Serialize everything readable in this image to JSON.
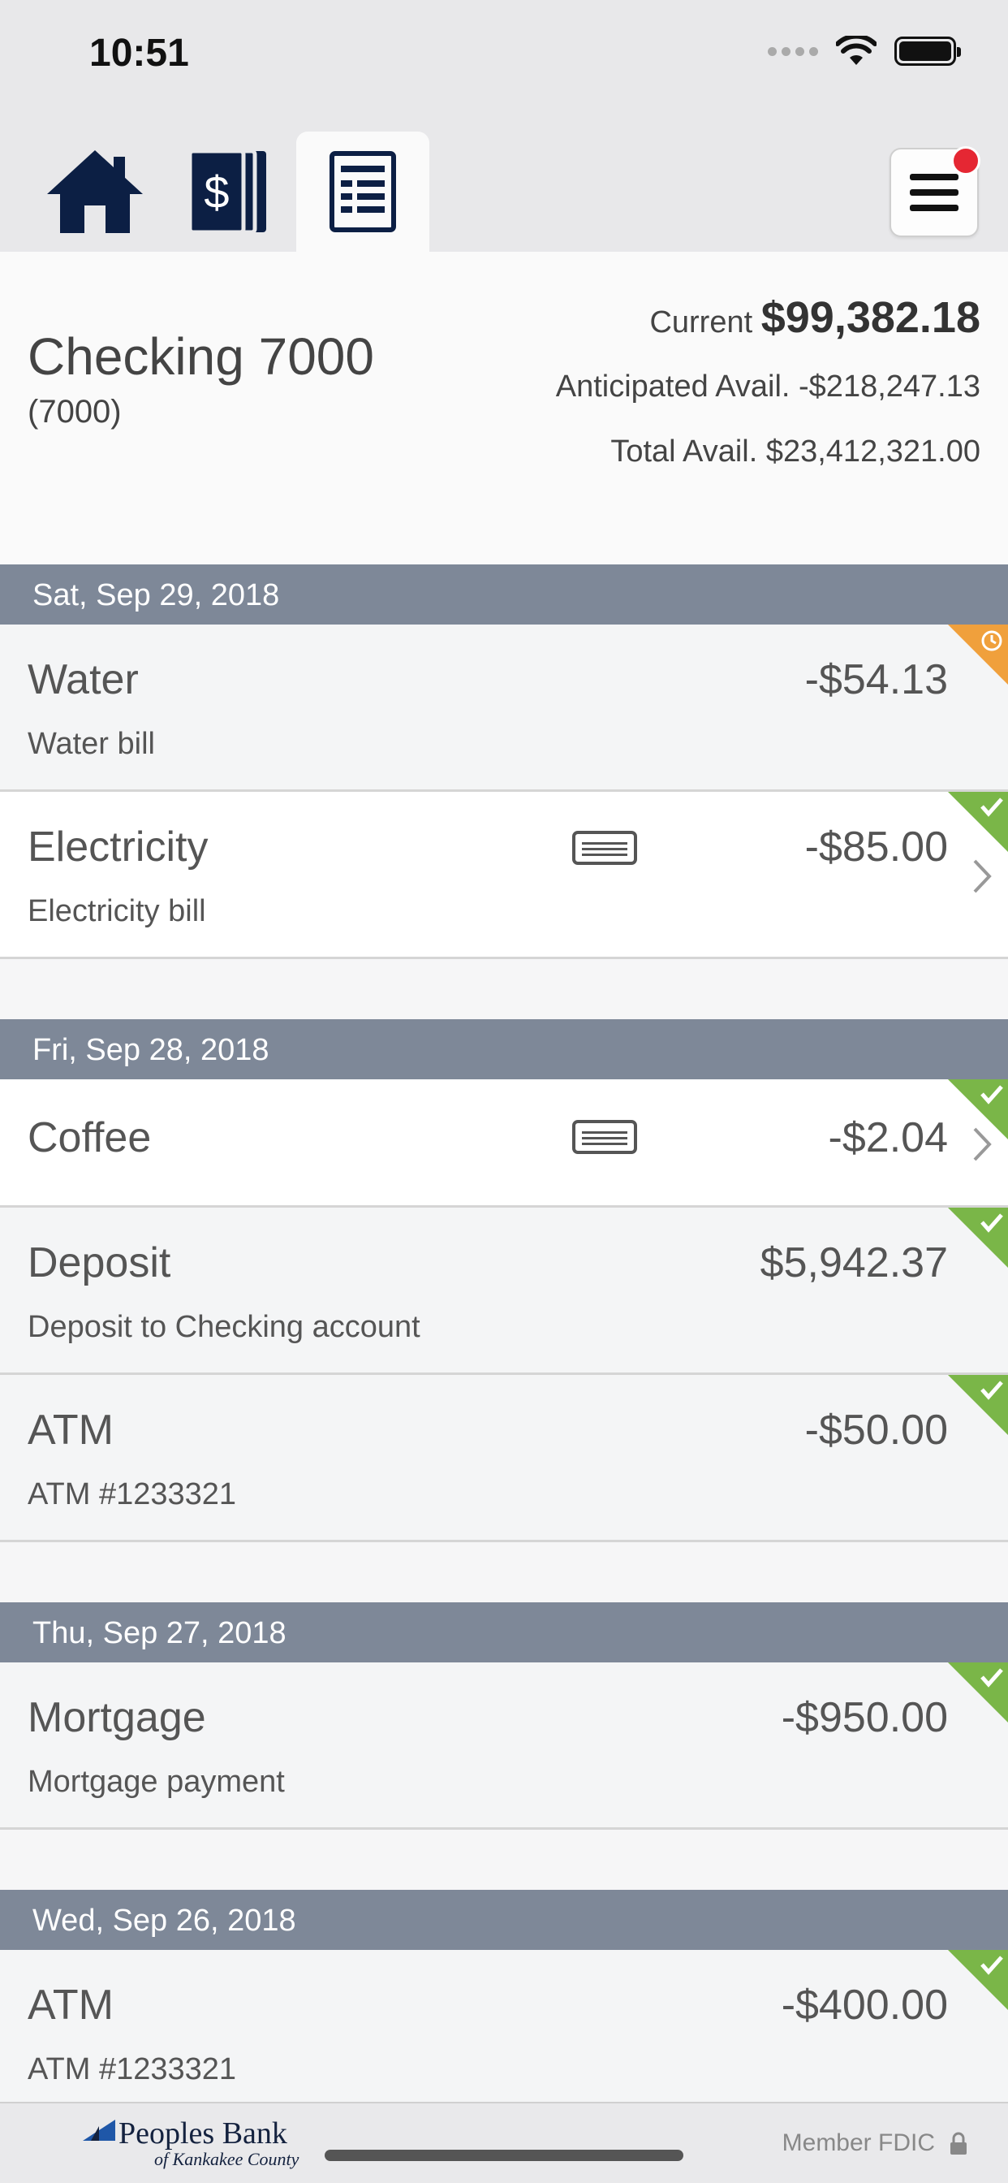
{
  "status_bar": {
    "time": "10:51"
  },
  "toolbar": {
    "tabs": [
      {
        "icon": "home-icon",
        "active": false
      },
      {
        "icon": "accounts-icon",
        "active": false
      },
      {
        "icon": "register-icon",
        "active": true
      }
    ],
    "menu_icon": "hamburger-menu-icon",
    "notification_badge_color": "#e52733"
  },
  "account": {
    "name": "Checking 7000",
    "number": "(7000)",
    "current_label": "Current",
    "current_value": "$99,382.18",
    "anticipated_label": "Anticipated Avail.",
    "anticipated_value": "-$218,247.13",
    "total_label": "Total Avail.",
    "total_value": "$23,412,321.00"
  },
  "groups": [
    {
      "date": "Sat, Sep 29, 2018",
      "transactions": [
        {
          "name": "Water",
          "memo": "Water bill",
          "amount": "-$54.13",
          "status": "pending",
          "has_card": false,
          "has_detail": false
        },
        {
          "name": "Electricity",
          "memo": "Electricity bill",
          "amount": "-$85.00",
          "status": "cleared",
          "has_card": true,
          "has_detail": true
        }
      ]
    },
    {
      "date": "Fri, Sep 28, 2018",
      "transactions": [
        {
          "name": "Coffee",
          "memo": "",
          "amount": "-$2.04",
          "status": "cleared",
          "has_card": true,
          "has_detail": true
        },
        {
          "name": "Deposit",
          "memo": "Deposit to Checking account",
          "amount": "$5,942.37",
          "status": "cleared",
          "has_card": false,
          "has_detail": false
        },
        {
          "name": "ATM",
          "memo": "ATM #1233321",
          "amount": "-$50.00",
          "status": "cleared",
          "has_card": false,
          "has_detail": false
        }
      ]
    },
    {
      "date": "Thu, Sep 27, 2018",
      "transactions": [
        {
          "name": "Mortgage",
          "memo": "Mortgage payment",
          "amount": "-$950.00",
          "status": "cleared",
          "has_card": false,
          "has_detail": false
        }
      ]
    },
    {
      "date": "Wed, Sep 26, 2018",
      "transactions": [
        {
          "name": "ATM",
          "memo": "ATM #1233321",
          "amount": "-$400.00",
          "status": "cleared",
          "has_card": false,
          "has_detail": false
        }
      ]
    }
  ],
  "footer": {
    "logo_name": "Peoples Bank",
    "logo_sub": "of Kankakee County",
    "fdic": "Member FDIC"
  },
  "colors": {
    "date_header": "#7e8898",
    "cleared": "#7ab648",
    "pending": "#f0a03c",
    "brand_navy": "#14223f"
  }
}
